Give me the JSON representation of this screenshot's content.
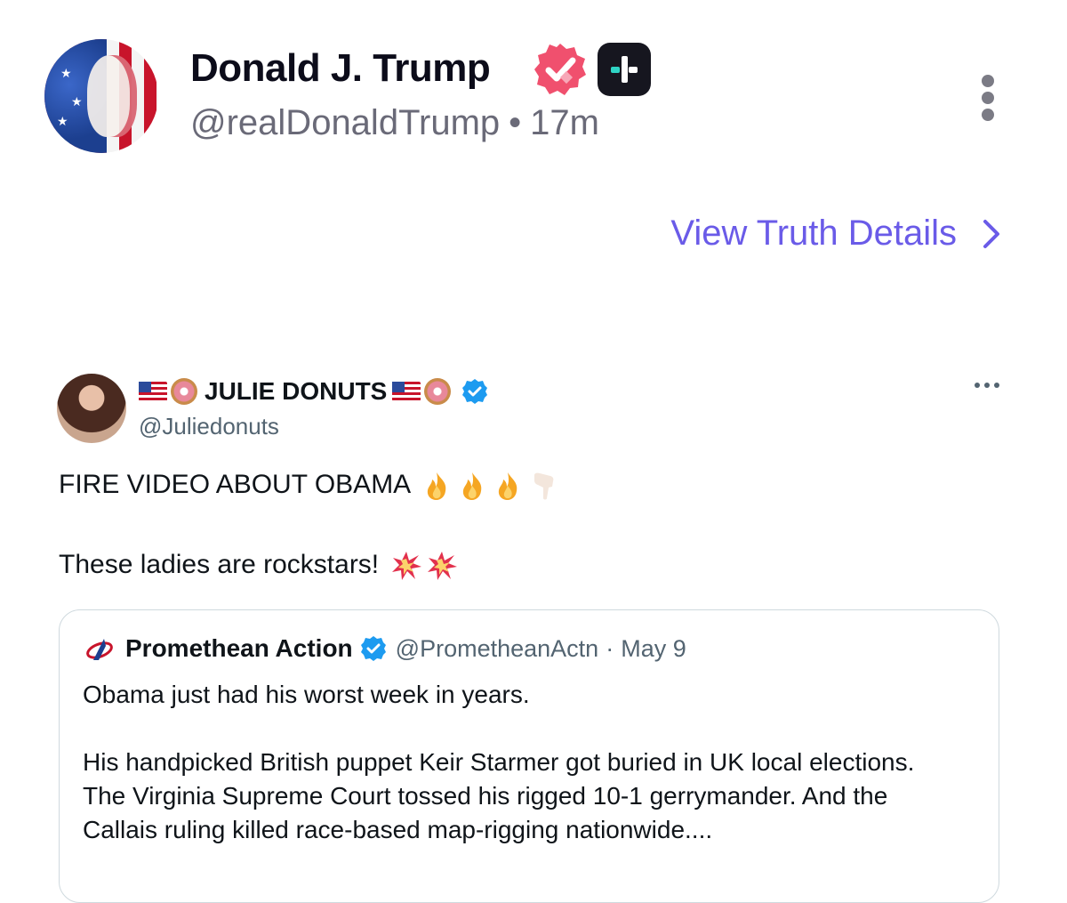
{
  "truth": {
    "display_name": "Donald J. Trump",
    "handle": "@realDonaldTrump",
    "separator": "•",
    "time_ago": "17m",
    "view_details_label": "View Truth Details"
  },
  "tweet": {
    "display_name": "JULIE DONUTS",
    "handle": "@Juliedonuts",
    "line1": "FIRE VIDEO ABOUT OBAMA",
    "line2": "These ladies are rockstars!"
  },
  "quote": {
    "display_name": "Promethean Action",
    "handle": "@PrometheanActn",
    "separator": "·",
    "date": "May 9",
    "line1": "Obama just had his worst week in years.",
    "line2": "His handpicked British puppet Keir Starmer got buried in UK local elections.",
    "line3": "The Virginia Supreme Court tossed his rigged 10-1 gerrymander. And the",
    "line4": "Callais ruling killed race-based map-rigging nationwide...."
  },
  "colors": {
    "truth_verified": "#f0506e",
    "link_purple": "#6a5be8",
    "twitter_blue_check": "#1d9bf0"
  },
  "icons": [
    "verified-badge-icon",
    "truth-plus-icon",
    "kebab-menu-icon",
    "chevron-right-icon",
    "us-flag-icon",
    "donut-icon",
    "blue-check-icon",
    "more-horizontal-icon",
    "fire-icon",
    "pointing-down-icon",
    "collision-icon",
    "promethean-logo-icon"
  ]
}
